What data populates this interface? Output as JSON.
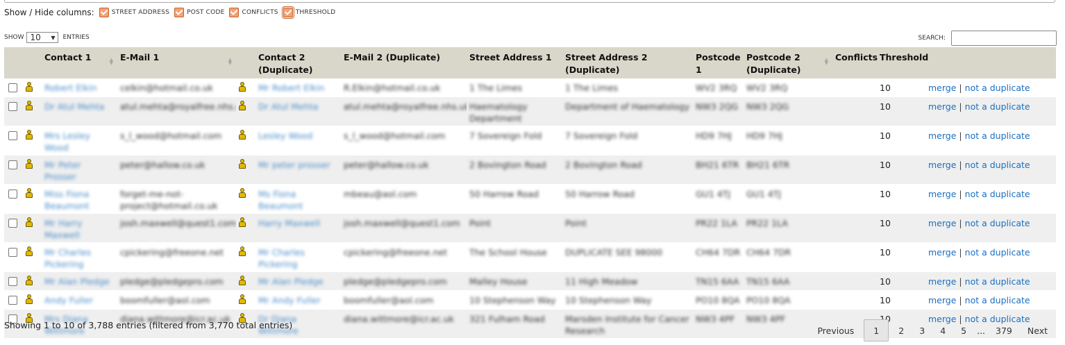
{
  "columns_toggle": {
    "title": "Show / Hide columns:",
    "options": [
      "STREET ADDRESS",
      "POST CODE",
      "CONFLICTS",
      "THRESHOLD"
    ]
  },
  "length": {
    "show": "SHOW",
    "value": "10",
    "entries": "ENTRIES"
  },
  "search": {
    "label": "SEARCH:",
    "value": ""
  },
  "headers": [
    "Contact 1",
    "E-Mail 1",
    "Contact 2 (Duplicate)",
    "E-Mail 2 (Duplicate)",
    "Street Address 1",
    "Street Address 2 (Duplicate)",
    "Postcode 1",
    "Postcode 2 (Duplicate)",
    "Conflicts",
    "Threshold"
  ],
  "rows": [
    {
      "contact1": "Robert Elkin",
      "email1": "celkin@hotmail.co.uk",
      "contact2": "Mr Robert Elkin",
      "email2": "R.Elkin@hotmail.co.uk",
      "addr1": "1 The Limes",
      "addr2": "1 The Limes",
      "pc1": "WV2 3RQ",
      "pc2": "WV2 3RQ",
      "conflicts": "",
      "threshold": "10"
    },
    {
      "contact1": "Dr Atul Mehta",
      "email1": "atul.mehta@royalfree.nhs.uk",
      "contact2": "Dr Atul Mehta",
      "email2": "atul.mehta@royalfree.nhs.uk",
      "addr1": "Haematology Department",
      "addr2": "Department of Haematology",
      "pc1": "NW3 2QG",
      "pc2": "NW3 2QG",
      "conflicts": "",
      "threshold": "10"
    },
    {
      "contact1": "Mrs Lesley Wood",
      "email1": "s_l_wood@hotmail.com",
      "contact2": "Lesley Wood",
      "email2": "s_l_wood@hotmail.com",
      "addr1": "7 Sovereign Fold",
      "addr2": "7 Sovereign Fold",
      "pc1": "HD9 7HJ",
      "pc2": "HD9 7HJ",
      "conflicts": "",
      "threshold": "10"
    },
    {
      "contact1": "Mr Peter Prosser",
      "email1": "peter@hallow.co.uk",
      "contact2": "Mr peter prosser",
      "email2": "peter@hallow.co.uk",
      "addr1": "2 Bovington Road",
      "addr2": "2 Bovington Road",
      "pc1": "BH21 6TR",
      "pc2": "BH21 6TR",
      "conflicts": "",
      "threshold": "10"
    },
    {
      "contact1": "Miss Fiona Beaumont",
      "email1": "forget-me-not-project@hotmail.co.uk",
      "contact2": "Ms Fiona Beaumont",
      "email2": "mbeau@aol.com",
      "addr1": "50 Harrow Road",
      "addr2": "50 Harrow Road",
      "pc1": "GU1 4TJ",
      "pc2": "GU1 4TJ",
      "conflicts": "",
      "threshold": "10"
    },
    {
      "contact1": "Mr Harry Maxwell",
      "email1": "josh.maxwell@quest1.com",
      "contact2": "Harry Maxwell",
      "email2": "josh.maxwell@quest1.com",
      "addr1": "Point",
      "addr2": "Point",
      "pc1": "PR22 1LA",
      "pc2": "PR22 1LA",
      "conflicts": "",
      "threshold": "10"
    },
    {
      "contact1": "Mr Charles Pickering",
      "email1": "cpickering@freeone.net",
      "contact2": "Mr Charles Pickering",
      "email2": "cpickering@freeone.net",
      "addr1": "The School House",
      "addr2": "DUPLICATE SEE 98000",
      "pc1": "CH64 7DR",
      "pc2": "CH64 7DR",
      "conflicts": "",
      "threshold": "10"
    },
    {
      "contact1": "Mr Alan Pledge",
      "email1": "pledge@pledgepro.com",
      "contact2": "Mr Alan Pledge",
      "email2": "pledge@pledgepro.com",
      "addr1": "Malley House",
      "addr2": "11 High Meadow",
      "pc1": "TN15 6AA",
      "pc2": "TN15 6AA",
      "conflicts": "",
      "threshold": "10"
    },
    {
      "contact1": "Andy Fuller",
      "email1": "boomfuller@aol.com",
      "contact2": "Mr Andy Fuller",
      "email2": "boomfuller@aol.com",
      "addr1": "10 Stephenson Way",
      "addr2": "10 Stephenson Way",
      "pc1": "PO10 8QA",
      "pc2": "PO10 8QA",
      "conflicts": "",
      "threshold": "10"
    },
    {
      "contact1": "Mrs Diana Wittmore",
      "email1": "diana.wittmore@icr.ac.uk",
      "contact2": "Dr Diana Wittmore",
      "email2": "diana.wittmore@icr.ac.uk",
      "addr1": "321 Fulham Road",
      "addr2": "Marsden Institute for Cancer Research",
      "pc1": "NW3 4PF",
      "pc2": "NW3 4PF",
      "conflicts": "",
      "threshold": "10"
    }
  ],
  "actions": {
    "merge": "merge",
    "sep": "|",
    "not_duplicate": "not a duplicate"
  },
  "footer": {
    "info": "Showing 1 to 10 of 3,788 entries (filtered from 3,770 total entries)",
    "previous": "Previous",
    "next": "Next",
    "pages": [
      "1",
      "2",
      "3",
      "4",
      "5"
    ],
    "ellipsis": "...",
    "last": "379"
  }
}
